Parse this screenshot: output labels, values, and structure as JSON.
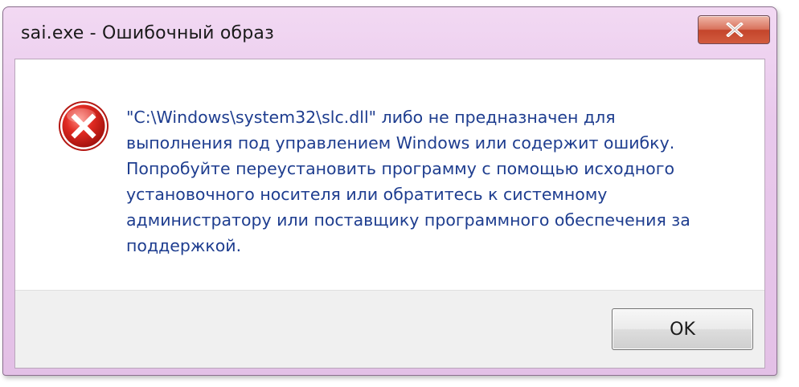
{
  "window": {
    "title": "sai.exe - Ошибочный образ"
  },
  "titlebar": {
    "close_icon": "close-icon"
  },
  "dialog": {
    "icon": "error-icon",
    "message": "\"C:\\Windows\\system32\\slc.dll\" либо не предназначен для\nвыполнения под управлением Windows или содержит ошибку.\nПопробуйте переустановить программу с помощью исходного\nустановочного носителя или обратитесь к системному\nадминистратору или поставщику программного обеспечения за\nподдержкой."
  },
  "buttons": {
    "ok_label": "OK"
  },
  "colors": {
    "frame": "#e6c3e8",
    "message_text": "#1e3d8f",
    "close_button": "#c4452b",
    "error_red": "#d61f1f"
  }
}
